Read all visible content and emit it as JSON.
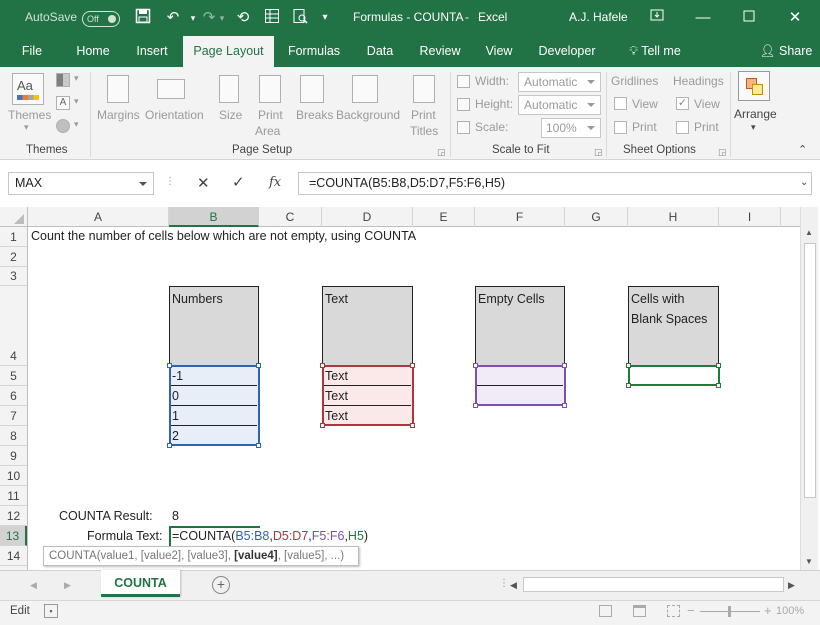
{
  "titlebar": {
    "autosave_label": "AutoSave",
    "autosave_state": "Off",
    "doc_title": "Formulas - COUNTA",
    "app_name": "Excel",
    "separator": "-",
    "user": "A.J. Hafele"
  },
  "tabs": [
    "File",
    "Home",
    "Insert",
    "Page Layout",
    "Formulas",
    "Data",
    "Review",
    "View",
    "Developer"
  ],
  "active_tab": "Page Layout",
  "tell_me": "Tell me",
  "share": "Share",
  "ribbon": {
    "themes": {
      "themes_label": "Themes",
      "group_label": "Themes"
    },
    "page_setup": {
      "margins": "Margins",
      "orientation": "Orientation",
      "size": "Size",
      "print_area_1": "Print",
      "print_area_2": "Area",
      "breaks": "Breaks",
      "background": "Background",
      "print_titles_1": "Print",
      "print_titles_2": "Titles",
      "group_label": "Page Setup"
    },
    "scale_to_fit": {
      "width_label": "Width:",
      "width_value": "Automatic",
      "height_label": "Height:",
      "height_value": "Automatic",
      "scale_label": "Scale:",
      "scale_value": "100%",
      "group_label": "Scale to Fit"
    },
    "sheet_options": {
      "gridlines": "Gridlines",
      "headings": "Headings",
      "view": "View",
      "print": "Print",
      "headings_view_checked": true,
      "group_label": "Sheet Options"
    },
    "arrange": {
      "label": "Arrange"
    }
  },
  "formula_bar": {
    "name_box": "MAX",
    "formula": "=COUNTA(B5:B8,D5:D7,F5:F6,H5)"
  },
  "columns": [
    "A",
    "B",
    "C",
    "D",
    "E",
    "F",
    "G",
    "H",
    "I"
  ],
  "selected_column": "B",
  "rows": [
    "1",
    "2",
    "3",
    "4",
    "5",
    "6",
    "7",
    "8",
    "9",
    "10",
    "11",
    "12",
    "13",
    "14"
  ],
  "selected_row": "13",
  "sheet": {
    "a1": "Count the number of cells below which are not empty, using COUNTA",
    "numbers_header": "Numbers",
    "numbers": [
      "-1",
      "0",
      "1",
      "2"
    ],
    "text_header": "Text",
    "texts": [
      "Text",
      "Text",
      "Text"
    ],
    "empty_header": "Empty Cells",
    "blank_header_1": "Cells with",
    "blank_header_2": "Blank Spaces",
    "counta_result_label": "COUNTA Result:",
    "counta_result_value": "8",
    "formula_text_label": "Formula Text:",
    "formula_parts": {
      "prefix": "=COUNTA(",
      "r1": "B5:B8",
      "c1": ",",
      "r2": "D5:D7",
      "c2": ",",
      "r3": "F5:F6",
      "c3": ",",
      "r4": "H5",
      "suffix": ")"
    }
  },
  "tooltip": {
    "pre": "COUNTA(value1, [value2], [value3], ",
    "bold": "[value4]",
    "post": ", [value5], ...)"
  },
  "sheet_tab": "COUNTA",
  "status": {
    "mode": "Edit",
    "zoom": "100%"
  },
  "colors": {
    "excel_green": "#217346",
    "range_blue": "#2e63b7",
    "range_red": "#b2353d",
    "range_purple": "#7d4fb0",
    "range_green": "#1e7b3a"
  }
}
